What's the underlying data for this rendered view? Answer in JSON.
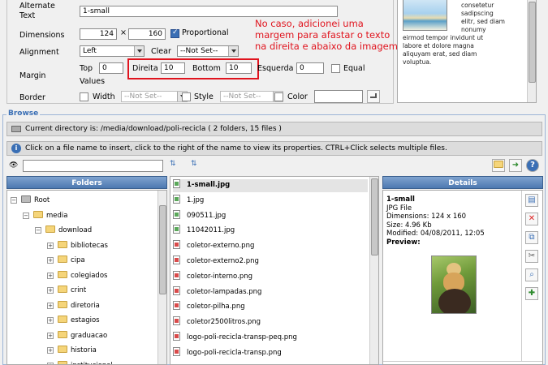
{
  "props": {
    "alt_label": "Alternate Text",
    "alt_value": "1-small",
    "dimensions_label": "Dimensions",
    "width_value": "124",
    "times": "×",
    "height_value": "160",
    "proportional_label": "Proportional",
    "alignment_label": "Alignment",
    "alignment_value": "Left",
    "clear_label": "Clear",
    "clear_value": "--Not Set--",
    "margin_label": "Margin",
    "top_label": "Top",
    "top_value": "0",
    "right_label": "Direita",
    "right_value": "10",
    "bottom_label": "Bottom",
    "bottom_value": "10",
    "left_label": "Esquerda",
    "left_value": "0",
    "equal_label": "Equal",
    "values_label": "Values",
    "border_label": "Border",
    "border_width_label": "Width",
    "border_width_value": "--Not Set--",
    "border_style_label": "Style",
    "border_style_value": "--Not Set--",
    "border_color_label": "Color"
  },
  "preview_text": [
    "consetetur",
    "sadipscing",
    "elitr, sed diam",
    "nonumy",
    "eirmod tempor invidunt ut",
    "labore et dolore magna",
    "aliquyam erat, sed diam",
    "voluptua."
  ],
  "annotation": {
    "lines": [
      "No caso, adicionei uma",
      "margem para afastar o texto",
      "na direita e abaixo da imagem"
    ]
  },
  "browse": {
    "legend": "Browse",
    "current_dir": "Current directory is: /media/download/poli-recicla ( 2 folders, 15 files )",
    "hint": "Click on a file name to insert, click to the right of the name to view its properties. CTRL+Click selects multiple files.",
    "folders_title": "Folders",
    "details_title": "Details"
  },
  "tree": [
    {
      "label": "Root",
      "level": 0
    },
    {
      "label": "media",
      "level": 1
    },
    {
      "label": "download",
      "level": 2
    },
    {
      "label": "bibliotecas",
      "level": 3
    },
    {
      "label": "cipa",
      "level": 3
    },
    {
      "label": "colegiados",
      "level": 3
    },
    {
      "label": "crint",
      "level": 3
    },
    {
      "label": "diretoria",
      "level": 3
    },
    {
      "label": "estagios",
      "level": 3
    },
    {
      "label": "graduacao",
      "level": 3
    },
    {
      "label": "historia",
      "level": 3
    },
    {
      "label": "institucional",
      "level": 3
    }
  ],
  "files": [
    {
      "name": "1-small.jpg",
      "type": "jpg",
      "selected": true
    },
    {
      "name": "1.jpg",
      "type": "jpg"
    },
    {
      "name": "090511.jpg",
      "type": "jpg"
    },
    {
      "name": "11042011.jpg",
      "type": "jpg"
    },
    {
      "name": "coletor-externo.png",
      "type": "png"
    },
    {
      "name": "coletor-externo2.png",
      "type": "png"
    },
    {
      "name": "coletor-interno.png",
      "type": "png"
    },
    {
      "name": "coletor-lampadas.png",
      "type": "png"
    },
    {
      "name": "coletor-pilha.png",
      "type": "png"
    },
    {
      "name": "coletor2500litros.png",
      "type": "png"
    },
    {
      "name": "logo-poli-recicla-transp-peq.png",
      "type": "png"
    },
    {
      "name": "logo-poli-recicla-transp.png",
      "type": "png"
    }
  ],
  "details": {
    "name": "1-small",
    "type": "JPG File",
    "dimensions": "Dimensions: 124 x 160",
    "size": "Size: 4.96 Kb",
    "modified": "Modified: 04/08/2011, 12:05",
    "preview_label": "Preview:"
  },
  "colors": {
    "panel_header": "#4d78b0",
    "annotation": "#e0141e",
    "highlight_box": "#e0141e"
  }
}
